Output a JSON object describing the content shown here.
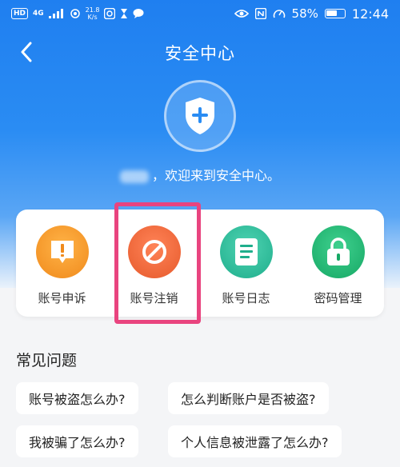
{
  "status_bar": {
    "network_badge": "HD",
    "signal": "4G",
    "speed_value": "21.8",
    "speed_unit": "K/s",
    "battery": "58%",
    "time": "12:44"
  },
  "header": {
    "title": "安全中心"
  },
  "welcome_text": "，欢迎来到安全中心。",
  "features": [
    {
      "label": "账号申诉",
      "color": "#f39a2b",
      "icon": "alert-icon"
    },
    {
      "label": "账号注销",
      "color": "#ec6a3c",
      "icon": "forbidden-icon"
    },
    {
      "label": "账号日志",
      "color": "#2bbd9a",
      "icon": "document-icon"
    },
    {
      "label": "密码管理",
      "color": "#1fb679",
      "icon": "lock-icon"
    }
  ],
  "faq": {
    "title": "常见问题",
    "items": [
      "账号被盗怎么办?",
      "怎么判断账户是否被盗?",
      "我被骗了怎么办?",
      "个人信息被泄露了怎么办?"
    ]
  }
}
